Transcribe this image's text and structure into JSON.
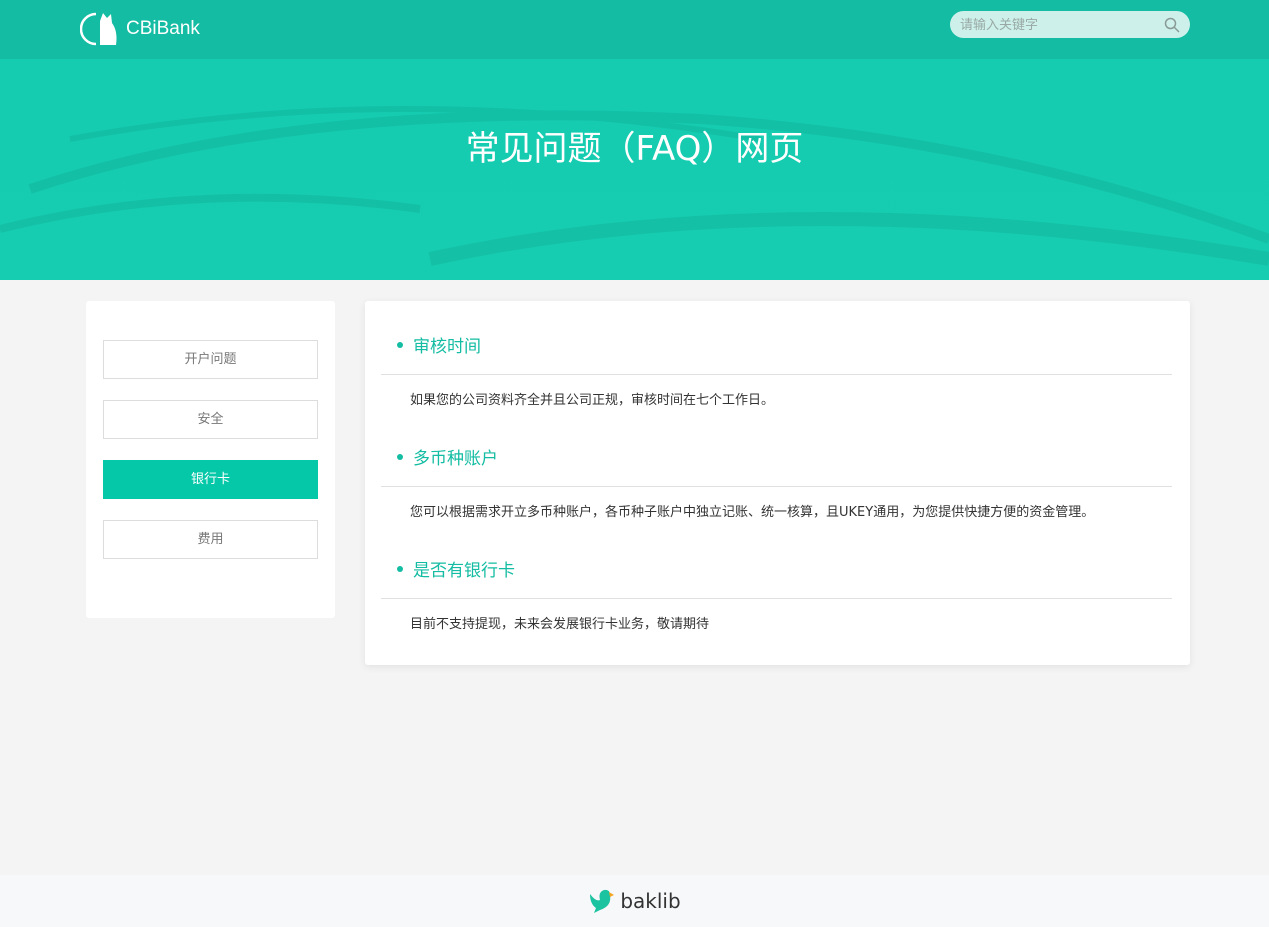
{
  "header": {
    "brand": "CBiBank",
    "search_placeholder": "请输入关键字"
  },
  "hero": {
    "title": "常见问题（FAQ）网页"
  },
  "sidebar": {
    "items": [
      {
        "label": "开户问题"
      },
      {
        "label": "安全"
      },
      {
        "label": "银行卡",
        "active": true
      },
      {
        "label": "费用"
      }
    ]
  },
  "faq": [
    {
      "question": "审核时间",
      "answer": "如果您的公司资料齐全并且公司正规，审核时间在七个工作日。"
    },
    {
      "question": "多币种账户",
      "answer": "您可以根据需求开立多币种账户，各币种子账户中独立记账、统一核算，且UKEY通用，为您提供快捷方便的资金管理。"
    },
    {
      "question": "是否有银行卡",
      "answer": "目前不支持提现，未来会发展银行卡业务，敬请期待"
    }
  ],
  "footer": {
    "brand": "baklib"
  },
  "colors": {
    "accent": "#13bca2",
    "active": "#04c8a8"
  }
}
